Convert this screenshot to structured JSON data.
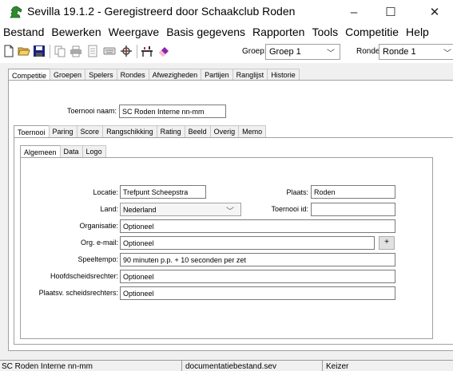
{
  "window": {
    "title": "Sevilla 19.1.2 - Geregistreerd door Schaakclub Roden",
    "controls": {
      "minimize": "–",
      "maximize": "☐",
      "close": "✕"
    }
  },
  "menu": [
    "Bestand",
    "Bewerken",
    "Weergave",
    "Basis gegevens",
    "Rapporten",
    "Tools",
    "Competitie",
    "Help"
  ],
  "toolbar": {
    "icons": [
      "new-document-icon",
      "open-folder-icon",
      "save-icon",
      "copy-icon",
      "print-icon",
      "print-preview-icon",
      "keyboard-icon",
      "pairing-tool-icon",
      "chess-table-icon",
      "eraser-icon"
    ],
    "group_label": "Groep:",
    "group_value": "Groep 1",
    "round_label": "Ronde:",
    "round_value": "Ronde 1"
  },
  "main_tabs": [
    "Competitie",
    "Groepen",
    "Spelers",
    "Rondes",
    "Afwezigheden",
    "Partijen",
    "Ranglijst",
    "Historie"
  ],
  "tournament_name_label": "Toernooi naam:",
  "tournament_name_value": "SC Roden Interne nn-mm",
  "sub_tabs": [
    "Toernooi",
    "Paring",
    "Score",
    "Rangschikking",
    "Rating",
    "Beeld",
    "Overig",
    "Memo"
  ],
  "inner_tabs": [
    "Algemeen",
    "Data",
    "Logo"
  ],
  "form": {
    "locatie_label": "Locatie:",
    "locatie_value": "Trefpunt Scheepstra",
    "plaats_label": "Plaats:",
    "plaats_value": "Roden",
    "land_label": "Land:",
    "land_value": "Nederland",
    "toernooi_id_label": "Toernooi id:",
    "toernooi_id_value": "",
    "organisatie_label": "Organisatie:",
    "organisatie_value": "Optioneel",
    "org_email_label": "Org. e-mail:",
    "org_email_value": "Optioneel",
    "plus_label": "+",
    "speeltempo_label": "Speeltempo:",
    "speeltempo_value": "90 minuten p.p. + 10 seconden per zet",
    "hoofd_label": "Hoofdscheidsrechter:",
    "hoofd_value": "Optioneel",
    "plaatsv_label": "Plaatsv. scheidsrechters:",
    "plaatsv_value": "Optioneel"
  },
  "status": {
    "tournament": "SC Roden Interne nn-mm",
    "file": "documentatiebestand.sev",
    "system": "Keizer"
  },
  "colors": {
    "accent_green": "#2e7d32",
    "window_bg": "#f0f0f0"
  }
}
